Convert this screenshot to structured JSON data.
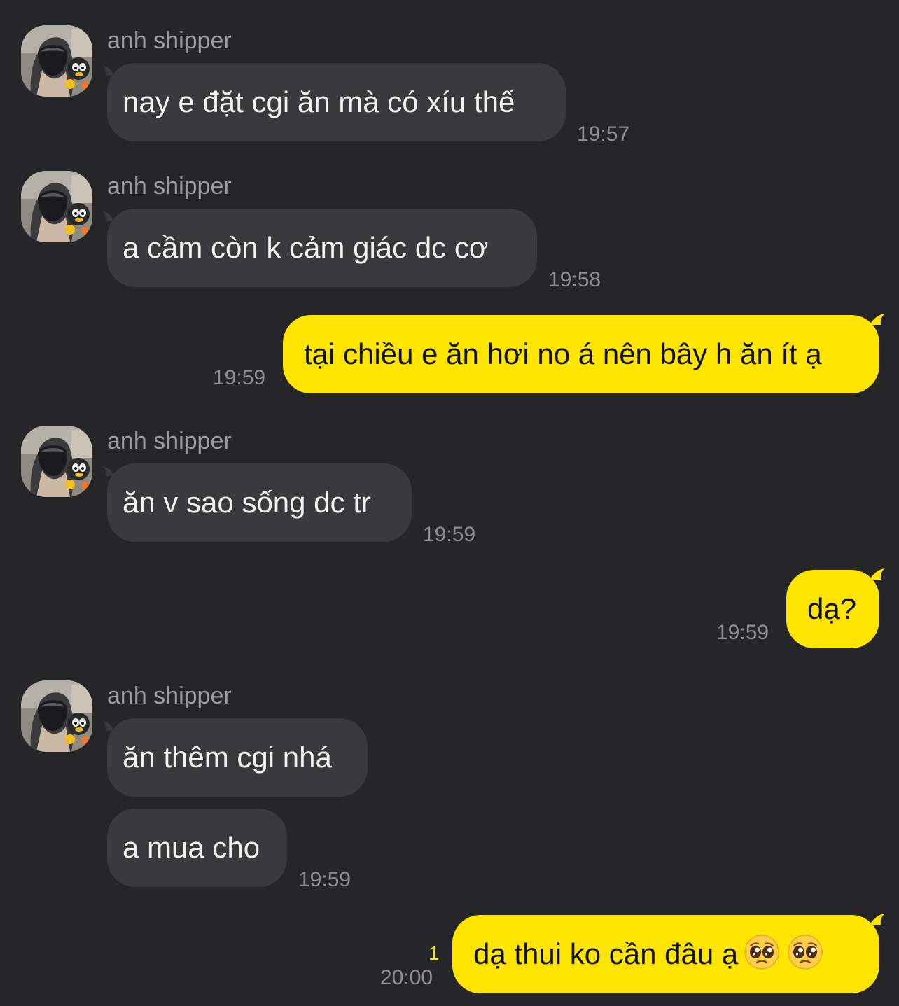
{
  "chat": {
    "sender_name": "anh shipper",
    "messages": [
      {
        "text": "nay e đặt cgi ăn mà có xíu thế",
        "time": "19:57"
      },
      {
        "text": "a cầm còn k cảm giác dc cơ",
        "time": "19:58"
      },
      {
        "text": "tại chiều e ăn hơi no á nên bây h ăn ít ạ",
        "time": "19:59"
      },
      {
        "text": "ăn v sao sống dc tr",
        "time": "19:59"
      },
      {
        "text": "dạ?",
        "time": "19:59"
      },
      {
        "text": "ăn thêm cgi nhá"
      },
      {
        "text": "a mua cho",
        "time": "19:59"
      },
      {
        "text": "dạ thui ko cần đâu ạ",
        "time": "20:00",
        "unread_count": "1",
        "emoji": [
          "pleading-face",
          "pleading-face"
        ]
      }
    ]
  },
  "colors": {
    "background": "#262628",
    "incoming_bubble": "#3a3a3c",
    "outgoing_bubble": "#fee500",
    "timestamp": "#8e8e93",
    "sender_name": "#9c9ca0"
  }
}
